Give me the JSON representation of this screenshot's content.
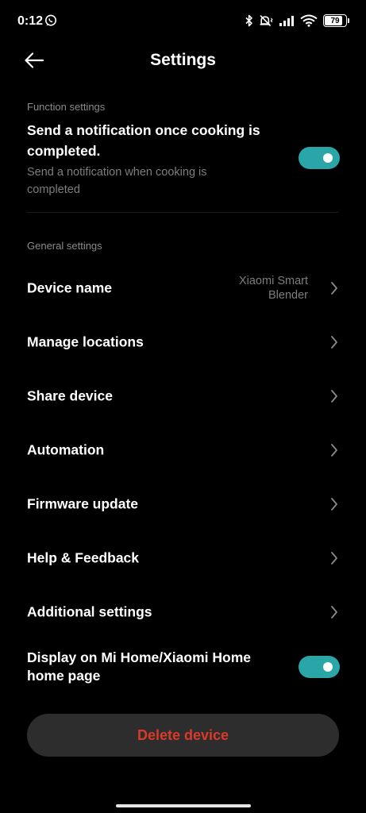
{
  "status_bar": {
    "time": "0:12",
    "battery": "79",
    "battery_level": 0.79,
    "icons": [
      "whatsapp-icon",
      "bluetooth-icon",
      "mute-vibrate-icon",
      "signal-icon",
      "wifi-icon",
      "battery-icon"
    ]
  },
  "header": {
    "title": "Settings",
    "back_icon": "arrow-left-icon"
  },
  "function_settings": {
    "section_label": "Function settings",
    "notify": {
      "title": "Send a notification once cooking is completed.",
      "subtitle": "Send a notification when cooking is completed",
      "enabled": true
    }
  },
  "general_settings": {
    "section_label": "General settings",
    "items": [
      {
        "label": "Device name",
        "value": "Xiaomi Smart Blender"
      },
      {
        "label": "Manage locations"
      },
      {
        "label": "Share device"
      },
      {
        "label": "Automation"
      },
      {
        "label": "Firmware update"
      },
      {
        "label": "Help & Feedback"
      },
      {
        "label": "Additional settings"
      }
    ],
    "display_home": {
      "title": "Display on Mi Home/Xiaomi Home home page",
      "enabled": true
    }
  },
  "delete_button": {
    "label": "Delete device"
  },
  "colors": {
    "background": "#000000",
    "toggle_on": "#2aa5a8",
    "delete_text": "#d93a2b",
    "delete_bg": "#2d2d2d",
    "secondary_text": "#7d7d7d"
  }
}
